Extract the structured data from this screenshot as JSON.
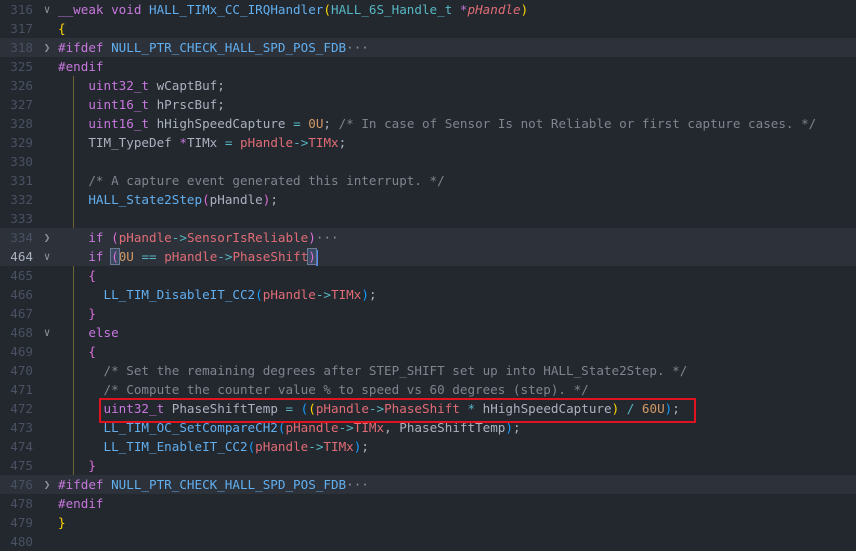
{
  "editor": {
    "lines": [
      {
        "num": "316",
        "fold": "open",
        "tokens": [
          [
            "__weak ",
            "kw"
          ],
          [
            "void ",
            "kw"
          ],
          [
            "HALL_TIMx_CC_IRQHandler",
            "fn"
          ],
          [
            "(",
            "b1"
          ],
          [
            "HALL_6S_Handle_t ",
            "ty"
          ],
          [
            "*",
            "kw"
          ],
          [
            "pHandle",
            "it"
          ],
          [
            ")",
            "b1"
          ]
        ]
      },
      {
        "num": "317",
        "tokens": [
          [
            "{",
            "b1"
          ]
        ]
      },
      {
        "num": "318",
        "fold": "closed",
        "hl": true,
        "tokens": [
          [
            "#ifdef ",
            "kw"
          ],
          [
            "NULL_PTR_CHECK_HALL_SPD_POS_FDB",
            "fn"
          ],
          [
            "···",
            "ell"
          ]
        ]
      },
      {
        "num": "325",
        "tokens": [
          [
            "#endif",
            "kw"
          ]
        ]
      },
      {
        "num": "326",
        "tokens": [
          [
            "    ",
            " "
          ],
          [
            "uint32_t ",
            "kw"
          ],
          [
            "wCaptBuf;",
            "pl"
          ]
        ]
      },
      {
        "num": "327",
        "tokens": [
          [
            "    ",
            " "
          ],
          [
            "uint16_t ",
            "kw"
          ],
          [
            "hPrscBuf;",
            "pl"
          ]
        ]
      },
      {
        "num": "328",
        "tokens": [
          [
            "    ",
            " "
          ],
          [
            "uint16_t ",
            "kw"
          ],
          [
            "hHighSpeedCapture ",
            "pl"
          ],
          [
            "= ",
            "op"
          ],
          [
            "0U",
            "num"
          ],
          [
            "; ",
            "pl"
          ],
          [
            "/* In case of Sensor Is not Reliable or first capture cases. */",
            "cm"
          ]
        ]
      },
      {
        "num": "329",
        "tokens": [
          [
            "    ",
            " "
          ],
          [
            "TIM_TypeDef ",
            "pl"
          ],
          [
            "*",
            "kw"
          ],
          [
            "TIMx ",
            "pl"
          ],
          [
            "= ",
            "op"
          ],
          [
            "pHandle",
            "var"
          ],
          [
            "->",
            "op"
          ],
          [
            "TIMx",
            "var"
          ],
          [
            ";",
            "pl"
          ]
        ]
      },
      {
        "num": "330",
        "tokens": []
      },
      {
        "num": "331",
        "tokens": [
          [
            "    ",
            " "
          ],
          [
            "/* A capture event generated this interrupt. */",
            "cm"
          ]
        ]
      },
      {
        "num": "332",
        "tokens": [
          [
            "    ",
            " "
          ],
          [
            "HALL_State2Step",
            "fn"
          ],
          [
            "(",
            "b2"
          ],
          [
            "pHandle",
            "pl"
          ],
          [
            ")",
            "b2"
          ],
          [
            ";",
            "pl"
          ]
        ]
      },
      {
        "num": "333",
        "tokens": []
      },
      {
        "num": "334",
        "fold": "closed",
        "hl": true,
        "tokens": [
          [
            "    ",
            " "
          ],
          [
            "if ",
            "kw"
          ],
          [
            "(",
            "b2"
          ],
          [
            "pHandle",
            "var"
          ],
          [
            "->",
            "op"
          ],
          [
            "SensorIsReliable",
            "var"
          ],
          [
            ")",
            "b2"
          ],
          [
            "···",
            "ell"
          ]
        ]
      },
      {
        "num": "464",
        "fold": "open",
        "hl": true,
        "active": true,
        "tokens": [
          [
            "    ",
            " "
          ],
          [
            "if ",
            "kw"
          ],
          [
            "(",
            "b2 bm"
          ],
          [
            "0U",
            "num"
          ],
          [
            " == ",
            "op"
          ],
          [
            "pHandle",
            "var"
          ],
          [
            "->",
            "op"
          ],
          [
            "PhaseShift",
            "var"
          ],
          [
            ")",
            "b2 bm"
          ],
          [
            "",
            "cursor"
          ]
        ]
      },
      {
        "num": "465",
        "tokens": [
          [
            "    ",
            " "
          ],
          [
            "{",
            "b2"
          ]
        ]
      },
      {
        "num": "466",
        "tokens": [
          [
            "      ",
            " "
          ],
          [
            "LL_TIM_DisableIT_CC2",
            "fn"
          ],
          [
            "(",
            "b3"
          ],
          [
            "pHandle",
            "var"
          ],
          [
            "->",
            "op"
          ],
          [
            "TIMx",
            "var"
          ],
          [
            ")",
            "b3"
          ],
          [
            ";",
            "pl"
          ]
        ]
      },
      {
        "num": "467",
        "tokens": [
          [
            "    ",
            " "
          ],
          [
            "}",
            "b2"
          ]
        ]
      },
      {
        "num": "468",
        "fold": "open",
        "tokens": [
          [
            "    ",
            " "
          ],
          [
            "else",
            "kw"
          ]
        ]
      },
      {
        "num": "469",
        "tokens": [
          [
            "    ",
            " "
          ],
          [
            "{",
            "b2"
          ]
        ]
      },
      {
        "num": "470",
        "tokens": [
          [
            "      ",
            " "
          ],
          [
            "/* Set the remaining degrees after STEP_SHIFT set up into HALL_State2Step. */",
            "cm"
          ]
        ]
      },
      {
        "num": "471",
        "tokens": [
          [
            "      ",
            " "
          ],
          [
            "/* Compute the counter value % to speed vs 60 degrees (step). */",
            "cm"
          ]
        ]
      },
      {
        "num": "472",
        "tokens": [
          [
            "      ",
            " "
          ],
          [
            "uint32_t ",
            "kw"
          ],
          [
            "PhaseShiftTemp ",
            "pl"
          ],
          [
            "= ",
            "op"
          ],
          [
            "(",
            "b3"
          ],
          [
            "(",
            "b1"
          ],
          [
            "pHandle",
            "var"
          ],
          [
            "->",
            "op"
          ],
          [
            "PhaseShift",
            "var"
          ],
          [
            " * ",
            "op"
          ],
          [
            "hHighSpeedCapture",
            "pl"
          ],
          [
            ")",
            "b1"
          ],
          [
            " / ",
            "op"
          ],
          [
            "60U",
            "num"
          ],
          [
            ")",
            "b3"
          ],
          [
            ";",
            "pl"
          ]
        ]
      },
      {
        "num": "473",
        "tokens": [
          [
            "      ",
            " "
          ],
          [
            "LL_TIM_OC_SetCompareCH2",
            "fn"
          ],
          [
            "(",
            "b3"
          ],
          [
            "pHandle",
            "var"
          ],
          [
            "->",
            "op"
          ],
          [
            "TIMx",
            "var"
          ],
          [
            ", PhaseShiftTemp",
            "pl"
          ],
          [
            ")",
            "b3"
          ],
          [
            ";",
            "pl"
          ]
        ]
      },
      {
        "num": "474",
        "tokens": [
          [
            "      ",
            " "
          ],
          [
            "LL_TIM_EnableIT_CC2",
            "fn"
          ],
          [
            "(",
            "b3"
          ],
          [
            "pHandle",
            "var"
          ],
          [
            "->",
            "op"
          ],
          [
            "TIMx",
            "var"
          ],
          [
            ")",
            "b3"
          ],
          [
            ";",
            "pl"
          ]
        ]
      },
      {
        "num": "475",
        "tokens": [
          [
            "    ",
            " "
          ],
          [
            "}",
            "b2"
          ]
        ]
      },
      {
        "num": "476",
        "fold": "closed",
        "hl": true,
        "tokens": [
          [
            "#ifdef ",
            "kw"
          ],
          [
            "NULL_PTR_CHECK_HALL_SPD_POS_FDB",
            "fn"
          ],
          [
            "···",
            "ell"
          ]
        ]
      },
      {
        "num": "478",
        "tokens": [
          [
            "#endif",
            "kw"
          ]
        ]
      },
      {
        "num": "479",
        "tokens": [
          [
            "}",
            "b1"
          ]
        ]
      },
      {
        "num": "480",
        "tokens": []
      }
    ]
  },
  "annotation": {
    "highlight_line": "472",
    "color": "#e0141e"
  }
}
